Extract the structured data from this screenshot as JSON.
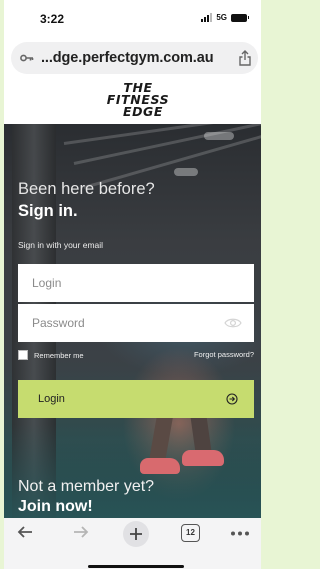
{
  "status_bar": {
    "time": "3:22",
    "network": "5G",
    "icons": [
      "signal-bars-icon",
      "battery-icon"
    ]
  },
  "browser": {
    "url_display": "...dge.perfectgym.com.au",
    "icons": [
      "key-icon",
      "share-icon"
    ]
  },
  "brand": {
    "logo_lines": [
      "THE",
      "FITNESS",
      "EDGE"
    ]
  },
  "login": {
    "heading_line1": "Been here before?",
    "heading_line2": "Sign in.",
    "helper": "Sign in with your email",
    "login_placeholder": "Login",
    "password_placeholder": "Password",
    "remember_label": "Remember me",
    "remember_checked": false,
    "forgot_link": "Forgot password?",
    "submit_label": "Login",
    "accent_color": "#c6dc6f"
  },
  "signup": {
    "line1": "Not a member yet?",
    "line2": "Join now!"
  },
  "bottom_toolbar": {
    "tab_count": "12",
    "icons": [
      "back-arrow-icon",
      "forward-arrow-icon",
      "plus-icon",
      "tabs-icon",
      "more-icon"
    ]
  }
}
